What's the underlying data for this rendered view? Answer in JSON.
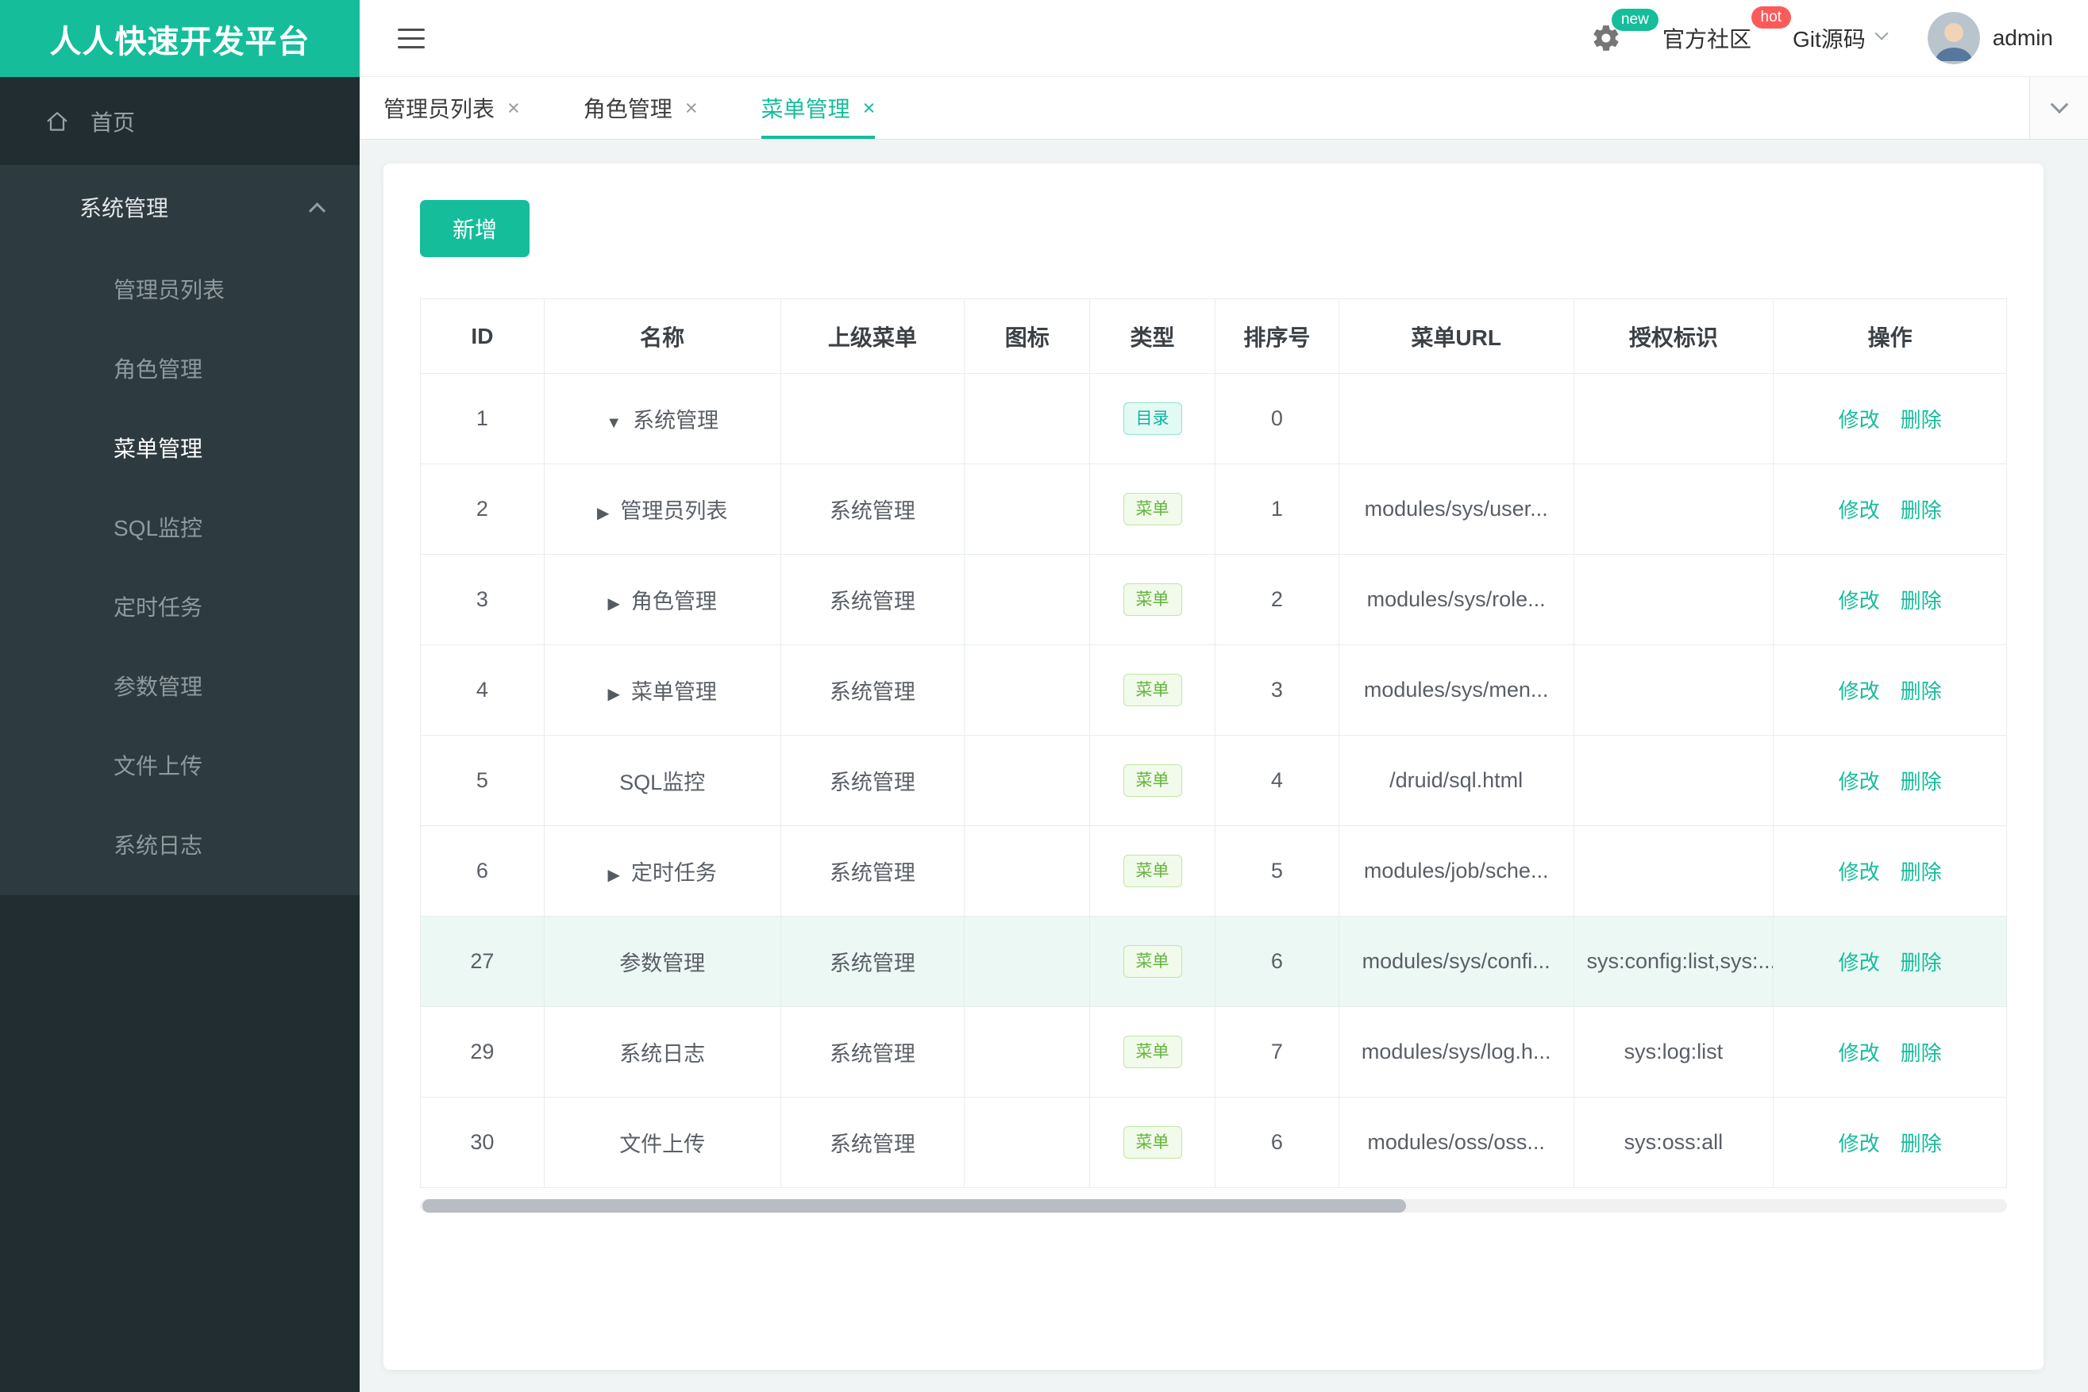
{
  "brand": {
    "title": "人人快速开发平台"
  },
  "colors": {
    "brand_teal": "#15bd9b",
    "badge_hot_red": "#fb5b5b",
    "tag_dir_teal": "#10b3a2",
    "tag_menu_green": "#62b63c",
    "row_highlight": "#ecf8f4"
  },
  "sidebar": {
    "home": {
      "label": "首页"
    },
    "section": {
      "label": "系统管理",
      "expanded": true
    },
    "items": [
      {
        "label": "管理员列表",
        "active": false
      },
      {
        "label": "角色管理",
        "active": false
      },
      {
        "label": "菜单管理",
        "active": true
      },
      {
        "label": "SQL监控",
        "active": false
      },
      {
        "label": "定时任务",
        "active": false
      },
      {
        "label": "参数管理",
        "active": false
      },
      {
        "label": "文件上传",
        "active": false
      },
      {
        "label": "系统日志",
        "active": false
      }
    ]
  },
  "header": {
    "badge_new": "new",
    "badge_hot": "hot",
    "community": "官方社区",
    "git": "Git源码",
    "user": "admin"
  },
  "tabs": [
    {
      "label": "管理员列表",
      "active": false
    },
    {
      "label": "角色管理",
      "active": false
    },
    {
      "label": "菜单管理",
      "active": true
    }
  ],
  "toolbar": {
    "add_label": "新增"
  },
  "icons": {
    "close": "×",
    "caret_down": "▼",
    "caret_right": "▶"
  },
  "table": {
    "headers": [
      "ID",
      "名称",
      "上级菜单",
      "图标",
      "类型",
      "排序号",
      "菜单URL",
      "授权标识",
      "操作"
    ],
    "actions": {
      "edit": "修改",
      "delete": "删除"
    },
    "rows": [
      {
        "id": "1",
        "expand": "down",
        "name": "系统管理",
        "parent": "",
        "icon": "",
        "type": "目录",
        "type_kind": "dir",
        "order": "0",
        "url": "",
        "perms": "",
        "highlight": false
      },
      {
        "id": "2",
        "expand": "right",
        "name": "管理员列表",
        "parent": "系统管理",
        "icon": "",
        "type": "菜单",
        "type_kind": "menu",
        "order": "1",
        "url": "modules/sys/user...",
        "perms": "",
        "highlight": false
      },
      {
        "id": "3",
        "expand": "right",
        "name": "角色管理",
        "parent": "系统管理",
        "icon": "",
        "type": "菜单",
        "type_kind": "menu",
        "order": "2",
        "url": "modules/sys/role...",
        "perms": "",
        "highlight": false
      },
      {
        "id": "4",
        "expand": "right",
        "name": "菜单管理",
        "parent": "系统管理",
        "icon": "",
        "type": "菜单",
        "type_kind": "menu",
        "order": "3",
        "url": "modules/sys/men...",
        "perms": "",
        "highlight": false
      },
      {
        "id": "5",
        "expand": null,
        "name": "SQL监控",
        "parent": "系统管理",
        "icon": "",
        "type": "菜单",
        "type_kind": "menu",
        "order": "4",
        "url": "/druid/sql.html",
        "perms": "",
        "highlight": false
      },
      {
        "id": "6",
        "expand": "right",
        "name": "定时任务",
        "parent": "系统管理",
        "icon": "",
        "type": "菜单",
        "type_kind": "menu",
        "order": "5",
        "url": "modules/job/sche...",
        "perms": "",
        "highlight": false
      },
      {
        "id": "27",
        "expand": null,
        "name": "参数管理",
        "parent": "系统管理",
        "icon": "",
        "type": "菜单",
        "type_kind": "menu",
        "order": "6",
        "url": "modules/sys/confi...",
        "perms": "sys:config:list,sys:...",
        "highlight": true
      },
      {
        "id": "29",
        "expand": null,
        "name": "系统日志",
        "parent": "系统管理",
        "icon": "",
        "type": "菜单",
        "type_kind": "menu",
        "order": "7",
        "url": "modules/sys/log.h...",
        "perms": "sys:log:list",
        "highlight": false
      },
      {
        "id": "30",
        "expand": null,
        "name": "文件上传",
        "parent": "系统管理",
        "icon": "",
        "type": "菜单",
        "type_kind": "menu",
        "order": "6",
        "url": "modules/oss/oss...",
        "perms": "sys:oss:all",
        "highlight": false
      }
    ]
  },
  "scrollbar": {
    "thumb_ratio": 0.62
  }
}
